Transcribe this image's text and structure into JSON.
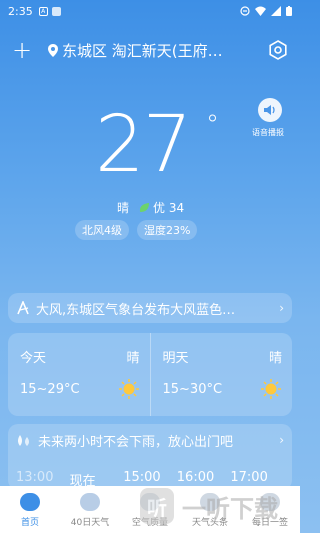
{
  "status_bar": {
    "time": "2:35",
    "icon_a": "A",
    "notification_icon": "circle-minus-icon",
    "wifi_icon": "wifi-icon",
    "signal_icon": "signal-icon",
    "battery_icon": "battery-icon"
  },
  "header": {
    "add_icon": "plus-icon",
    "location_icon": "pin-icon",
    "location": "东城区 淘汇新天(王府…",
    "settings_icon": "settings-icon"
  },
  "current": {
    "temperature": "27",
    "degree": "°",
    "condition": "晴",
    "aqi_icon": "leaf-icon",
    "aqi": "优 34",
    "wind": "北风4级",
    "humidity": "湿度23%",
    "voice_label": "语音播报"
  },
  "alert": {
    "text": "大风,东城区气象台发布大风蓝色…",
    "chevron": "›"
  },
  "daily": [
    {
      "label": "今天",
      "condition": "晴",
      "range": "15~29°C",
      "icon": "sun-icon"
    },
    {
      "label": "明天",
      "condition": "晴",
      "range": "15~30°C",
      "icon": "sun-icon"
    }
  ],
  "precip": {
    "text": "未来两小时不会下雨，放心出门吧",
    "chevron": "›"
  },
  "hours": [
    "13:00",
    "现在",
    "15:00",
    "16:00",
    "17:00"
  ],
  "nav": [
    {
      "label": "首页",
      "active": true
    },
    {
      "label": "40日天气",
      "active": false
    },
    {
      "label": "空气质量",
      "active": false
    },
    {
      "label": "天气头条",
      "active": false
    },
    {
      "label": "每日一签",
      "active": false
    }
  ],
  "watermark": {
    "logo_char": "听",
    "text": "一听下载"
  },
  "colors": {
    "accent": "#3d8fe6",
    "aqi_green": "#6cd36c",
    "sun": "#ffc93c"
  }
}
